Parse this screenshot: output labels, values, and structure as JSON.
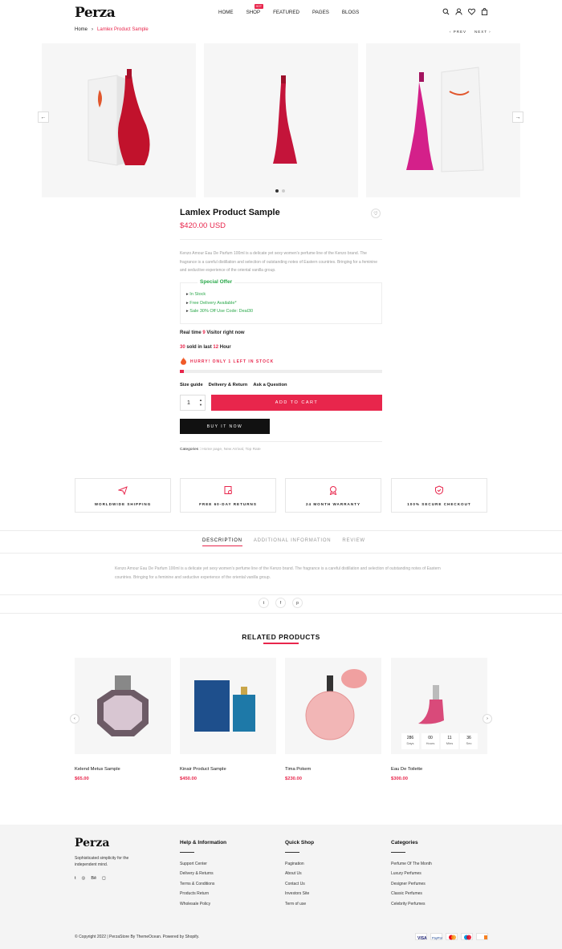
{
  "header": {
    "logo": "Perza",
    "nav": [
      {
        "label": "HOME"
      },
      {
        "label": "SHOP",
        "badge": "HOT"
      },
      {
        "label": "FEATURED"
      },
      {
        "label": "PAGES"
      },
      {
        "label": "BLOGS"
      }
    ]
  },
  "breadcrumb": {
    "home": "Home",
    "separator": "›",
    "current": "Lamlex Product Sample"
  },
  "pager": {
    "prev": "‹ PREV",
    "next": "NEXT ›"
  },
  "gallery": {
    "prev": "←",
    "next": "→"
  },
  "product": {
    "title": "Lamlex Product Sample",
    "price": "$420.00 USD",
    "description": "Kenzo Amour Eau De Parfum 100ml is a delicate yet sexy women's perfume line of the Kenzo brand. The fragrance is a careful distillation and selection of outstanding notes of Eastern countries. Bringing for a feminine and seductive experience of the oriental vanilla group.",
    "offer_title": "Special Offer",
    "offer_items": [
      "In Stock",
      "Free Delivery Available*",
      "Sale 30% Off Use Code: Deal30"
    ],
    "realtime_prefix": "Real time ",
    "realtime_count": "9",
    "realtime_suffix": " Visitor right now",
    "sold_count": "30",
    "sold_mid": " sold in last ",
    "sold_hours": "12",
    "sold_suffix": " Hour",
    "hurry": "HURRY! ONLY 1 LEFT IN STOCK",
    "stock_fraction": 0.02,
    "links": [
      "Size guide",
      "Delivery & Return",
      "Ask a Question"
    ],
    "qty": "1",
    "add_to_cart": "ADD TO CART",
    "buy_now": "BUY IT NOW",
    "categories_label": "Categories : ",
    "categories_value": "Home page, New Arrival, Top Rate"
  },
  "features": [
    "WORLDWIDE SHIPPING",
    "FREE 60-DAY RETURNS",
    "24 MONTH WARRANTY",
    "100% SECURE CHECKOUT"
  ],
  "tabs": [
    "DESCRIPTION",
    "ADDITIONAL INFORMATION",
    "REVIEW"
  ],
  "tab_description": "Kenzo Amour Eau De Parfum 100ml is a delicate yet sexy women's perfume line of the Kenzo brand. The fragrance is a careful distillation and selection of outstanding notes of Eastern countries. Bringing for a feminine and seductive experience of the oriental vanilla group.",
  "share": [
    "t",
    "f",
    "p"
  ],
  "related": {
    "title": "RELATED PRODUCTS",
    "items": [
      {
        "name": "Kelend Metus Sample",
        "price": "$65.00"
      },
      {
        "name": "Kinair Product Sample",
        "price": "$450.00"
      },
      {
        "name": "Tima Pokem",
        "price": "$230.00"
      },
      {
        "name": "Eau De Toilette",
        "price": "$300.00"
      }
    ],
    "countdown": [
      {
        "v": "286",
        "l": "Days"
      },
      {
        "v": "00",
        "l": "Hours"
      },
      {
        "v": "11",
        "l": "Mins"
      },
      {
        "v": "36",
        "l": "Sec"
      }
    ]
  },
  "footer": {
    "logo": "Perza",
    "tagline": "Sophisticated simplicity for the independent mind.",
    "social": [
      "t",
      "◎",
      "Bē",
      "◻"
    ],
    "cols": [
      {
        "title": "Help & Information",
        "items": [
          "Support Center",
          "Delivery & Returns",
          "Terms & Conditions",
          "Products Return",
          "Wholesale Policy"
        ]
      },
      {
        "title": "Quick Shop",
        "items": [
          "Pagination",
          "About Us",
          "Contact Us",
          "Investors Site",
          "Term of use"
        ]
      },
      {
        "title": "Categories",
        "items": [
          "Perfume Of The Month",
          "Luxury Perfumes",
          "Designer Perfumes",
          "Classic Perfumes",
          "Celebrity Perfumes"
        ]
      }
    ],
    "copyright": "© Copyright 2022 | PerzaStore By ThemeOcean. Powered by Shopify.",
    "payments": [
      "VISA",
      "PayPal",
      "Mastercard",
      "Maestro",
      "Discover"
    ]
  },
  "colors": {
    "accent": "#e8264c",
    "green": "#2aa84a",
    "dark": "#111111"
  }
}
